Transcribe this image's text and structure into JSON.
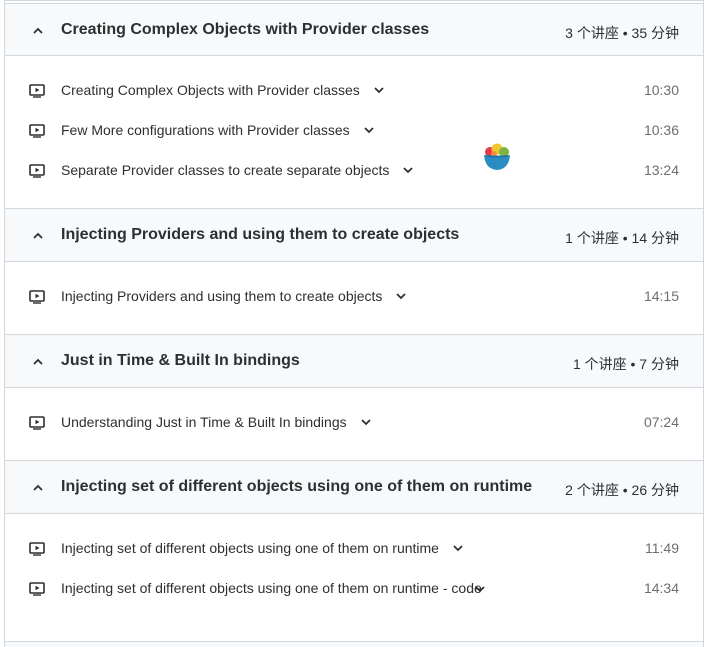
{
  "sections": [
    {
      "title": "Creating Complex Objects with Provider classes",
      "meta": "3 个讲座 • 35 分钟",
      "lectures": [
        {
          "title": "Creating Complex Objects with Provider classes",
          "duration": "10:30"
        },
        {
          "title": "Few More configurations with Provider classes",
          "duration": "10:36"
        },
        {
          "title": "Separate Provider classes to create separate objects",
          "duration": "13:24"
        }
      ]
    },
    {
      "title": "Injecting Providers and using them to create objects",
      "meta": "1 个讲座 • 14 分钟",
      "lectures": [
        {
          "title": "Injecting Providers and using them to create objects",
          "duration": "14:15"
        }
      ]
    },
    {
      "title": "Just in Time & Built In bindings",
      "meta": "1 个讲座 • 7 分钟",
      "lectures": [
        {
          "title": "Understanding Just in Time & Built In bindings",
          "duration": "07:24"
        }
      ]
    },
    {
      "title": "Injecting set of different objects using one of them on runtime",
      "meta": "2 个讲座 • 26 分钟",
      "lectures": [
        {
          "title": "Injecting set of different objects using one of them on runtime",
          "duration": "11:49"
        },
        {
          "title": "Injecting set of different objects using one of them on runtime - code",
          "duration": "14:34"
        }
      ]
    }
  ],
  "icons": {
    "section_toggle": "chevron-up-icon",
    "lecture_type": "video-play-icon",
    "lecture_expand": "chevron-down-icon",
    "overlay": "salad-bowl-icon"
  },
  "colors": {
    "header_bg": "#f7f9fa",
    "border": "#d1d7dc",
    "text": "#2d2f31",
    "muted": "#6a6f73"
  }
}
